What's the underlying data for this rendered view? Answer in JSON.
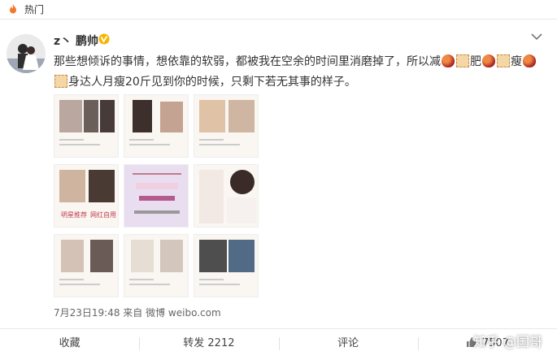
{
  "header": {
    "section_label": "热门"
  },
  "post": {
    "username": "z丶 鹏帅",
    "text_part1": "那些想倾诉的事情，想依靠的软弱，都被我在空余的时间里消磨掉了，所以减",
    "text_part2": "肥",
    "text_part3": "瘦",
    "text_part4": "身达人月瘦20斤见到你的时候，只剩下若无其事的样子。",
    "timestamp_source": "7月23日19:48 来自 微博 weibo.com"
  },
  "actions": {
    "favorite": "收藏",
    "repost": "转发 2212",
    "comment": "评论",
    "like": "7507"
  },
  "watermark": "知乎 @国哥",
  "images": [
    {
      "caption_a": "",
      "caption_b": ""
    },
    {
      "caption_a": "",
      "caption_b": ""
    },
    {
      "caption_a": "",
      "caption_b": ""
    },
    {
      "caption_a": "明星推荐",
      "caption_b": "网红自用"
    },
    {
      "caption_a": "",
      "caption_b": ""
    },
    {
      "caption_a": "",
      "caption_b": ""
    },
    {
      "caption_a": "",
      "caption_b": ""
    },
    {
      "caption_a": "",
      "caption_b": ""
    },
    {
      "caption_a": "",
      "caption_b": ""
    }
  ]
}
